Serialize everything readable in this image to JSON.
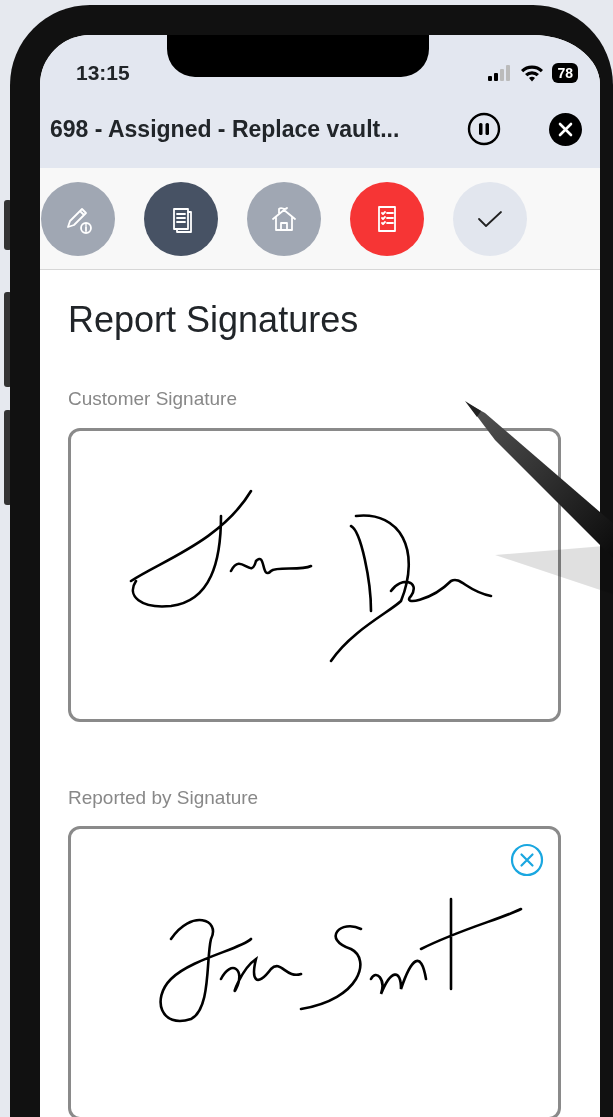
{
  "status_bar": {
    "time": "13:15",
    "battery": "78"
  },
  "header": {
    "title": "698 - Assigned - Replace vault..."
  },
  "steps": [
    {
      "kind": "info",
      "color": "#a0a7b3",
      "selected": false
    },
    {
      "kind": "documents",
      "color": "#475264",
      "selected": false
    },
    {
      "kind": "house",
      "color": "#a0a7b3",
      "selected": false
    },
    {
      "kind": "checklist",
      "selected": true
    },
    {
      "kind": "check",
      "color": "#e2e6ee",
      "selected": false
    }
  ],
  "page_title": "Report Signatures",
  "signatures": [
    {
      "label": "Customer Signature",
      "clear_button": false
    },
    {
      "label": "Reported by Signature",
      "clear_button": true
    }
  ]
}
